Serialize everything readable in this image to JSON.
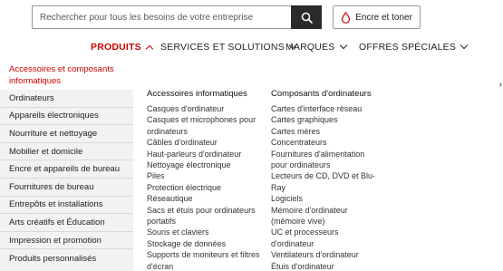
{
  "search": {
    "placeholder": "Rechercher pour tous les besoins de votre entreprise"
  },
  "ink_button": {
    "label": "Encre et toner",
    "icon": "ink-drop-icon",
    "icon_color": "#cc0000"
  },
  "nav": {
    "items": [
      {
        "label": "PRODUITS",
        "active": true
      },
      {
        "label": "SERVICES ET SOLUTIONS",
        "active": false
      },
      {
        "label": "MARQUES",
        "active": false
      },
      {
        "label": "OFFRES SPÉCIALES",
        "active": false
      }
    ]
  },
  "colors": {
    "accent": "#cc0000",
    "menu_bg": "#f2f2f2",
    "search_button_bg": "#2b2b2b"
  },
  "left_menu": {
    "selected": "Accessoires et composants informatiques",
    "items": [
      "Ordinateurs",
      "Appareils électroniques",
      "Nourriture et nettoyage",
      "Mobilier et domicile",
      "Encre et appareils de bureau",
      "Fournitures de bureau",
      "Entrepôts et installations",
      "Arts créatifs et Éducation",
      "Impression et promotion",
      "Produits personnalisés"
    ]
  },
  "columns": [
    {
      "heading": "Accessoires informatiques",
      "links": [
        "Casques d'ordinateur",
        "Casques et microphones pour ordinateurs",
        "Câbles d'ordinateur",
        "Haut-parleurs d'ordinateur",
        "Nettoyage électronique",
        "Piles",
        "Protection électrique",
        "Réseautique",
        "Sacs et étuis pour ordinateurs portatifs",
        "Souris et claviers",
        "Stockage de données",
        "Supports de moniteurs et filtres d'écran"
      ]
    },
    {
      "heading": "Composants d'ordinateurs",
      "links": [
        "Cartes d'interface réseau",
        "Cartes graphiques",
        "Cartes mères",
        "Concentrateurs",
        "Fournitures d'alimentation pour ordinateurs",
        "Lecteurs de CD, DVD et Blu-Ray",
        "Logiciels",
        "Mémoire d'ordinateur (mémoire vive)",
        "UC et processeurs d'ordinateur",
        "Ventilateurs d'ordinateur",
        "Étuis d'ordinateur"
      ]
    }
  ]
}
